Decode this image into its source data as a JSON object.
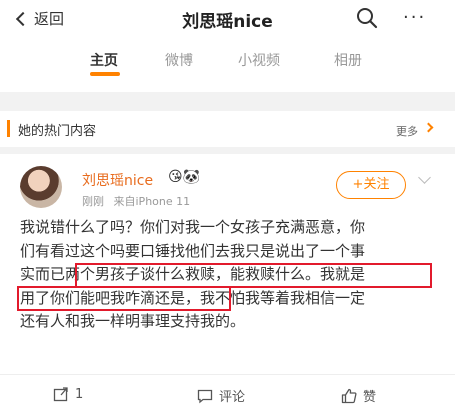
{
  "topbar": {
    "back_label": "返回",
    "title": "刘思瑶nice",
    "search_icon": "search-icon",
    "more_icon": "more-icon",
    "more_glyph": "···"
  },
  "tabs": [
    {
      "label": "主页",
      "active": true
    },
    {
      "label": "微博",
      "active": false
    },
    {
      "label": "小视频",
      "active": false
    },
    {
      "label": "相册",
      "active": false
    }
  ],
  "accent_color": "#ff8200",
  "section": {
    "title": "她的热门内容",
    "more_label": "更多"
  },
  "post": {
    "author": "刘思瑶nice",
    "badges": "😘🐼",
    "time": "刚刚",
    "source": "来自iPhone 11",
    "follow_label": "+关注",
    "lines": [
      "我说错什么了吗？你们对我一个女孩子充满恶意，你",
      "们有看过这个吗要口锤找他们去我只是说出了一个事",
      "实而已两个男孩子谈什么救赎，能救赎什么。我就是",
      "用了你们能吧我咋滴还是，我不怕我等着我相信一定",
      "还有人和我一样明事理支持我的。"
    ],
    "highlight_color": "#e21a2c"
  },
  "actions": {
    "repost_count": "1",
    "comment_label": "评论",
    "like_label": "赞"
  }
}
